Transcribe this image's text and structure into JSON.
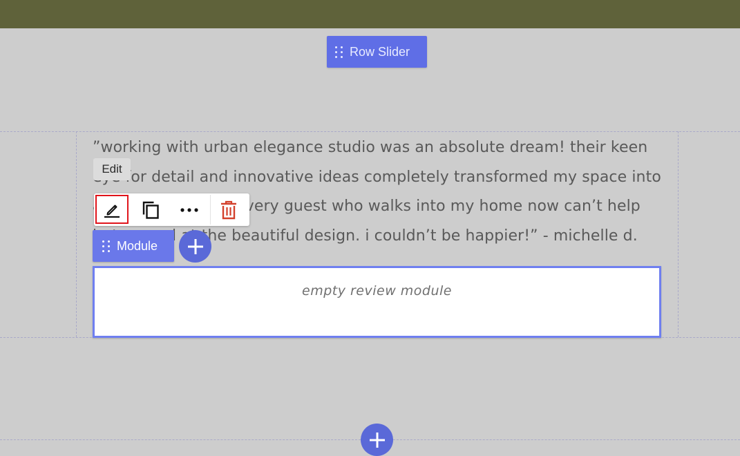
{
  "row": {
    "label": "Row Slider"
  },
  "quote": {
    "line1": "”working with urban elegance studio was an absolute dream! their keen",
    "line2": "eye for detail and innovative ideas completely transformed my space into",
    "line3": "a stunning haven. every guest who walks into my home now can’t help",
    "line4": "but marvel at the beautiful design. i couldn’t be happier!” - michelle d."
  },
  "tooltip": {
    "text": "Edit"
  },
  "toolbar": {
    "edit_icon": "pencil-icon",
    "copy_icon": "copy-icon",
    "more_icon": "more-horizontal-icon",
    "delete_icon": "trash-icon",
    "delete_color": "#d3402b",
    "highlight_color": "#e0141b"
  },
  "module": {
    "label": "Module"
  },
  "review_module": {
    "placeholder": "empty review module"
  },
  "colors": {
    "topbar": "#5f623a",
    "row_button": "#5f6ee6",
    "module_button": "#6a78ea",
    "module_border": "#6f7ff0",
    "plus_button": "#5a69d8"
  }
}
